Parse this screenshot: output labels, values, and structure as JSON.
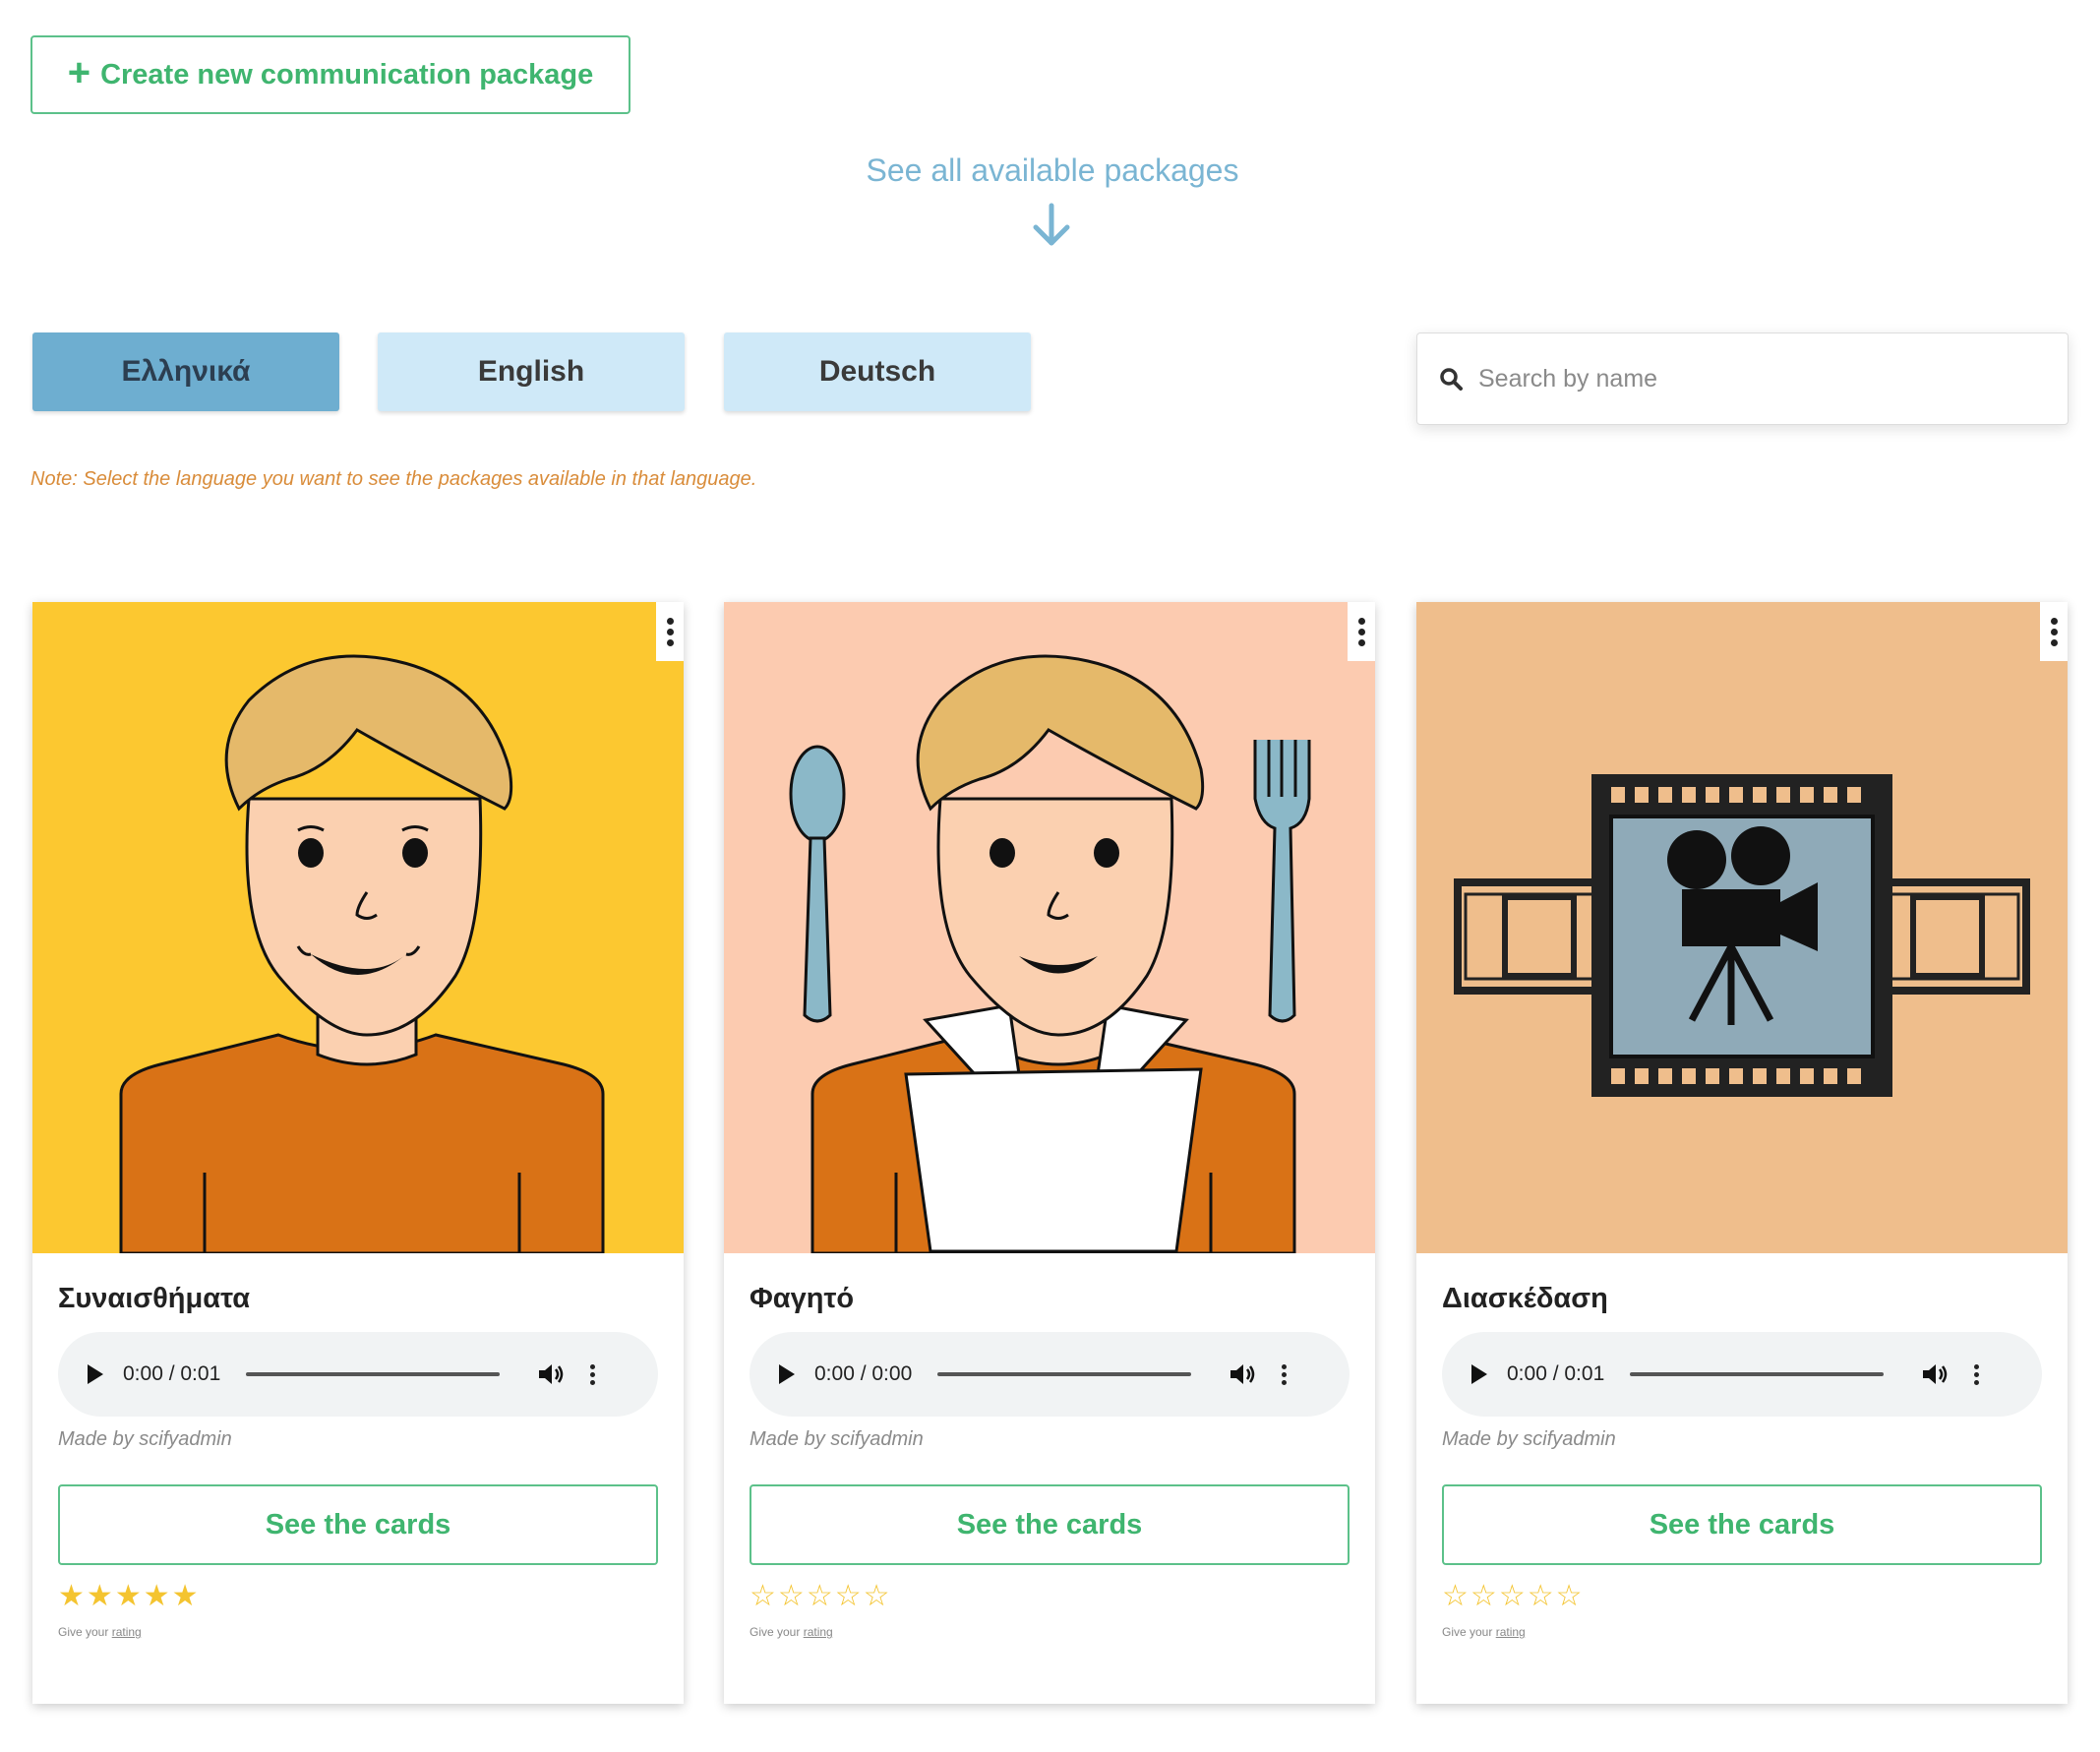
{
  "create_button": {
    "icon": "plus-icon",
    "label": "Create new communication package"
  },
  "see_all": {
    "label": "See all available packages",
    "icon": "arrow-down-icon"
  },
  "languages": [
    {
      "label": "Ελληνικά",
      "active": true
    },
    {
      "label": "English",
      "active": false
    },
    {
      "label": "Deutsch",
      "active": false
    }
  ],
  "search": {
    "placeholder": "Search by name",
    "value": "",
    "icon": "search-icon"
  },
  "note": "Note: Select the language you want to see the packages available in that language.",
  "packages": [
    {
      "title": "Συναισθήματα",
      "image": "smiling-boy-illustration",
      "background": "#fcc830",
      "audio_time": "0:00 / 0:01",
      "made_by": "Made by scifyadmin",
      "see_cards_label": "See the cards",
      "rating": 5,
      "rating_note_prefix": "Give your",
      "rating_note_link": "rating"
    },
    {
      "title": "Φαγητό",
      "image": "boy-with-napkin-spoon-fork-illustration",
      "background": "#fccbb0",
      "audio_time": "0:00 / 0:00",
      "made_by": "Made by scifyadmin",
      "see_cards_label": "See the cards",
      "rating": 0,
      "rating_note_prefix": "Give your",
      "rating_note_link": "rating"
    },
    {
      "title": "Διασκέδαση",
      "image": "film-reel-camera-illustration",
      "background": "#efbe8c",
      "audio_time": "0:00 / 0:01",
      "made_by": "Made by scifyadmin",
      "see_cards_label": "See the cards",
      "rating": 0,
      "rating_note_prefix": "Give your",
      "rating_note_link": "rating"
    }
  ],
  "colors": {
    "accent_green": "#3fb56f",
    "link_blue": "#7ab5d3",
    "lang_active": "#6eaed0",
    "lang_idle": "#cfe9f8",
    "note_orange": "#d98c3a",
    "star": "#f4c430"
  }
}
